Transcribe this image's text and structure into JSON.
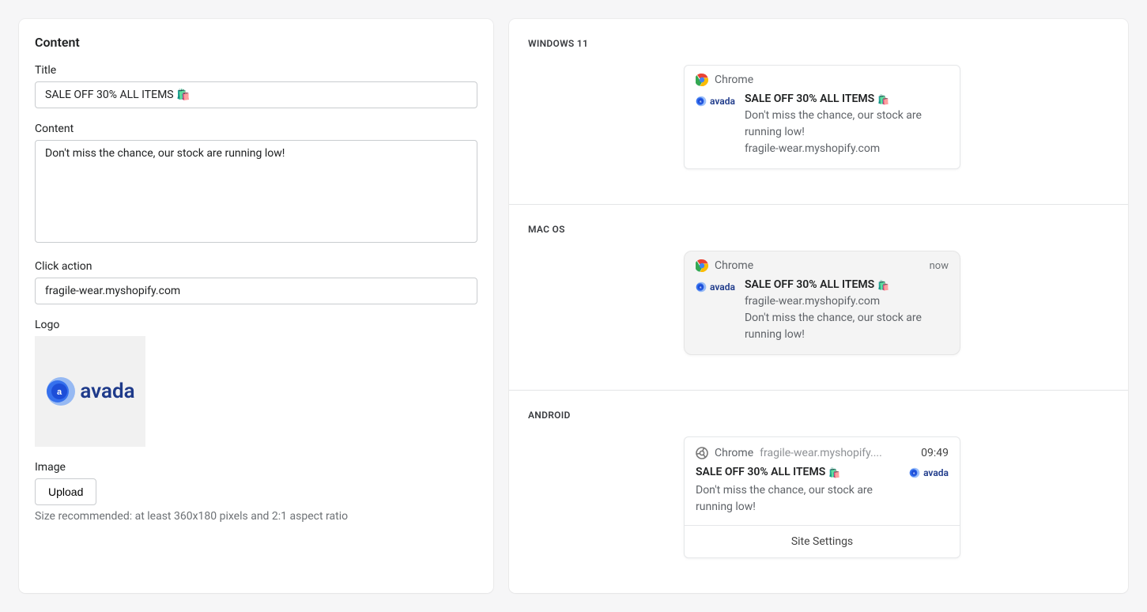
{
  "form": {
    "section_title": "Content",
    "title_label": "Title",
    "title_value": "SALE OFF 30% ALL ITEMS 🛍️",
    "content_label": "Content",
    "content_value": "Don't miss the chance, our stock are running low!",
    "click_action_label": "Click action",
    "click_action_value": "fragile-wear.myshopify.com",
    "logo_label": "Logo",
    "logo_brand": "avada",
    "image_label": "Image",
    "upload_button": "Upload",
    "image_hint": "Size recommended: at least 360x180 pixels and 2:1 aspect ratio"
  },
  "preview": {
    "windows": {
      "label": "WINDOWS 11",
      "browser": "Chrome",
      "title": "SALE OFF 30% ALL ITEMS",
      "body": "Don't miss the chance, our stock are running low!",
      "domain": "fragile-wear.myshopify.com"
    },
    "mac": {
      "label": "MAC OS",
      "browser": "Chrome",
      "time": "now",
      "title": "SALE OFF 30% ALL ITEMS",
      "domain": "fragile-wear.myshopify.com",
      "body": "Don't miss the chance, our stock are running low!"
    },
    "android": {
      "label": "ANDROID",
      "browser": "Chrome",
      "domain": "fragile-wear.myshopify....",
      "time": "09:49",
      "title": "SALE OFF 30% ALL ITEMS",
      "body": "Don't miss the chance, our stock are running low!",
      "settings": "Site Settings"
    }
  }
}
